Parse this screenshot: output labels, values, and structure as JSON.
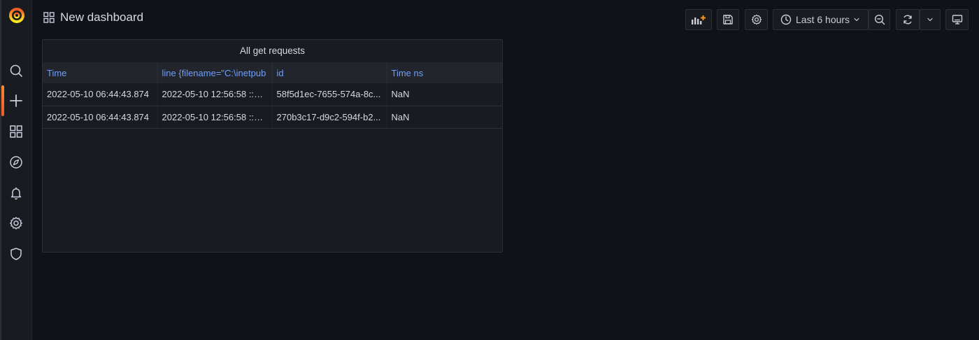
{
  "app": {
    "name": "Grafana"
  },
  "header": {
    "title": "New dashboard"
  },
  "toolbar": {
    "time_range": "Last 6 hours"
  },
  "panel": {
    "title": "All get requests",
    "columns": [
      "Time",
      "line {filename=\"C:\\inetpub",
      "id",
      "Time ns"
    ],
    "rows": [
      [
        "2022-05-10 06:44:43.874",
        "2022-05-10 12:56:58 ::1 ...",
        "58f5d1ec-7655-574a-8c...",
        "NaN"
      ],
      [
        "2022-05-10 06:44:43.874",
        "2022-05-10 12:56:58 ::1 ...",
        "270b3c17-d9c2-594f-b2...",
        "NaN"
      ]
    ]
  },
  "colors": {
    "background": "#111217",
    "panel": "#181b1f",
    "accent": "#f05a28",
    "link": "#6e9fff"
  },
  "icons": {
    "sidebar": [
      "grafana-logo-icon",
      "search-icon",
      "plus-icon",
      "dashboards-icon",
      "compass-icon",
      "bell-icon",
      "gear-icon",
      "shield-icon"
    ],
    "toolbar": [
      "add-panel-icon",
      "save-icon",
      "gear-icon",
      "clock-icon",
      "chevron-down-icon",
      "zoom-out-icon",
      "refresh-icon",
      "chevron-down-icon",
      "tv-icon"
    ]
  }
}
